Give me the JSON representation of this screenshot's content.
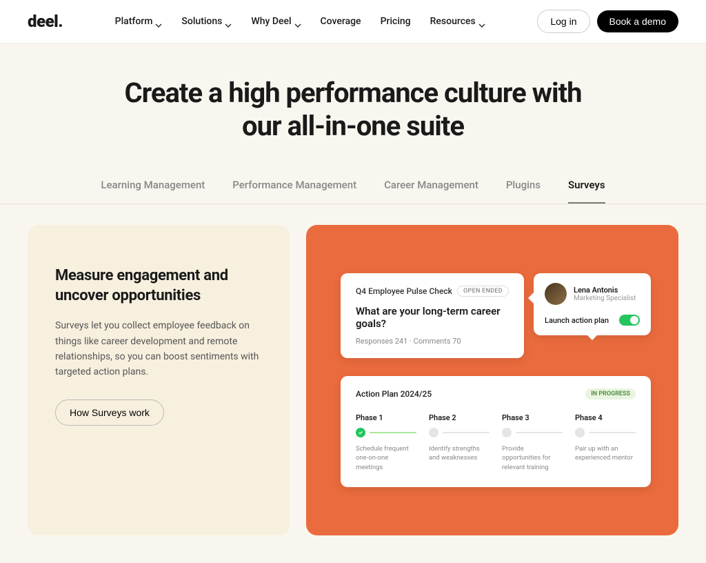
{
  "header": {
    "logo": "deel.",
    "nav": [
      "Platform",
      "Solutions",
      "Why Deel",
      "Coverage",
      "Pricing",
      "Resources"
    ],
    "nav_has_dropdown": [
      true,
      true,
      true,
      false,
      false,
      true
    ],
    "login": "Log in",
    "demo": "Book a demo"
  },
  "hero": {
    "title": "Create a high performance culture with our all-in-one suite"
  },
  "tabs": [
    "Learning Management",
    "Performance Management",
    "Career Management",
    "Plugins",
    "Surveys"
  ],
  "active_tab": 4,
  "left": {
    "title": "Measure engagement and uncover opportunities",
    "body": "Surveys let you collect employee feedback on things like career development and remote relationships, so you can boost sentiments with targeted action plans.",
    "cta": "How Surveys work"
  },
  "survey": {
    "name": "Q4 Employee Pulse Check",
    "badge": "OPEN ENDED",
    "question": "What are your long-term career goals?",
    "meta": "Responses 241  ·  Comments 70"
  },
  "person": {
    "name": "Lena Antonis",
    "role": "Marketing Specialist",
    "action": "Launch action plan"
  },
  "plan": {
    "title": "Action Plan 2024/25",
    "status": "IN PROGRESS",
    "phases": [
      {
        "label": "Phase 1",
        "desc": "Schedule frequent one-on-one meetings",
        "done": true
      },
      {
        "label": "Phase 2",
        "desc": "Identify strengths and weaknesses",
        "done": false
      },
      {
        "label": "Phase 3",
        "desc": "Provide opportunities for relevant training",
        "done": false
      },
      {
        "label": "Phase 4",
        "desc": "Pair up with an experienced mentor",
        "done": false
      }
    ]
  }
}
